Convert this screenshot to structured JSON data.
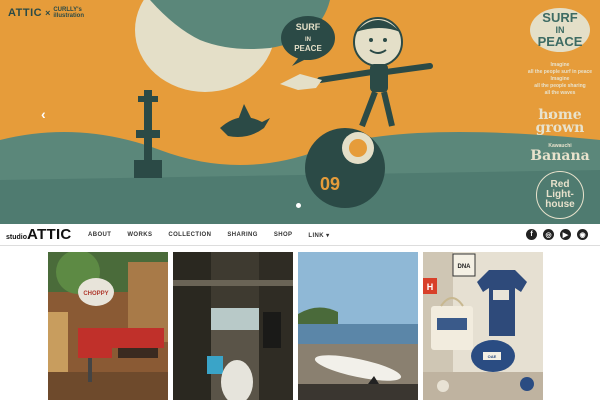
{
  "hero": {
    "brand": {
      "attic": "ATTIC",
      "x": "×",
      "curlly_line1": "CURLLY's",
      "curlly_line2": "illustration"
    },
    "bubble_text": [
      "SURF",
      "IN",
      "PEACE"
    ],
    "year_text": "09",
    "right_col": {
      "surf_badge_line1": "SURF",
      "surf_badge_line2": "IN",
      "surf_badge_line3": "PEACE",
      "imagine_lines": [
        "Imagine",
        "all the people surf in peace",
        "Imagine",
        "all the people sharing",
        "all the waves"
      ],
      "homegrown_line1": "home",
      "homegrown_line2": "grown",
      "banana_top": "Kawauchi",
      "banana": "Banana",
      "redlight_line1": "Red",
      "redlight_line2": "Light-",
      "redlight_line3": "house"
    },
    "arrow_prev": "‹",
    "arrow_next": "›",
    "colors": {
      "bg": "#e69c3a",
      "teal": "#5b877a",
      "cream": "#e4dfc8",
      "dark": "#2b4a46"
    }
  },
  "navbar": {
    "logo_studio": "studio",
    "logo_attic": "ATTIC",
    "menu": [
      "ABOUT",
      "WORKS",
      "COLLECTION",
      "SHARING",
      "SHOP",
      "LINK ▾"
    ],
    "social_icons": [
      "facebook-icon",
      "instagram-icon",
      "youtube-icon",
      "rss-icon"
    ]
  },
  "thumbnails": [
    {
      "name": "shop-interior-red-chair",
      "signs": [
        "CHOPPY"
      ]
    },
    {
      "name": "doorway-sea-view"
    },
    {
      "name": "beach-surfboard"
    },
    {
      "name": "merch-shirt-bag-helmet",
      "signs": [
        "DNA",
        "H",
        "OAE"
      ]
    }
  ]
}
